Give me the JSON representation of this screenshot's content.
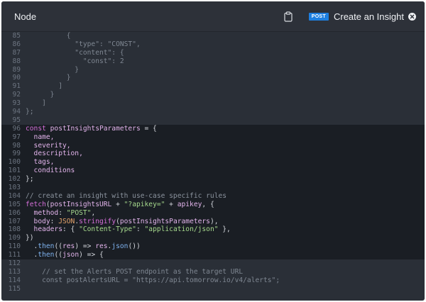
{
  "header": {
    "language": "Node",
    "method_badge": "POST",
    "endpoint_title": "Create an Insight"
  },
  "icons": {
    "clipboard": "clipboard-icon",
    "close": "close-circle-icon"
  },
  "colors": {
    "panel_bg": "#2a2f37",
    "highlight_bg": "#1a1e24",
    "method_badge_bg": "#1e7fe0"
  },
  "code": {
    "lines": [
      {
        "n": "85",
        "hl": false,
        "tokens": [
          {
            "t": "          {",
            "c": "dim"
          }
        ]
      },
      {
        "n": "86",
        "hl": false,
        "tokens": [
          {
            "t": "            \"type\": \"CONST\",",
            "c": "dim"
          }
        ]
      },
      {
        "n": "87",
        "hl": false,
        "tokens": [
          {
            "t": "            \"content\": {",
            "c": "dim"
          }
        ]
      },
      {
        "n": "88",
        "hl": false,
        "tokens": [
          {
            "t": "              \"const\": 2",
            "c": "dim"
          }
        ]
      },
      {
        "n": "89",
        "hl": false,
        "tokens": [
          {
            "t": "            }",
            "c": "dim"
          }
        ]
      },
      {
        "n": "90",
        "hl": false,
        "tokens": [
          {
            "t": "          }",
            "c": "dim"
          }
        ]
      },
      {
        "n": "91",
        "hl": false,
        "tokens": [
          {
            "t": "        ]",
            "c": "dim"
          }
        ]
      },
      {
        "n": "92",
        "hl": false,
        "tokens": [
          {
            "t": "      }",
            "c": "dim"
          }
        ]
      },
      {
        "n": "93",
        "hl": false,
        "tokens": [
          {
            "t": "    ]",
            "c": "dim"
          }
        ]
      },
      {
        "n": "94",
        "hl": false,
        "tokens": [
          {
            "t": "};",
            "c": "dim"
          }
        ]
      },
      {
        "n": "95",
        "hl": false,
        "tokens": [
          {
            "t": "",
            "c": "dim"
          }
        ]
      },
      {
        "n": "96",
        "hl": true,
        "tokens": [
          {
            "t": "const ",
            "c": "kw"
          },
          {
            "t": "postInsightsParameters",
            "c": "var"
          },
          {
            "t": " = {",
            "c": "pl"
          }
        ]
      },
      {
        "n": "97",
        "hl": true,
        "tokens": [
          {
            "t": "  name,",
            "c": "var"
          }
        ]
      },
      {
        "n": "98",
        "hl": true,
        "tokens": [
          {
            "t": "  severity,",
            "c": "var"
          }
        ]
      },
      {
        "n": "99",
        "hl": true,
        "tokens": [
          {
            "t": "  description,",
            "c": "var"
          }
        ]
      },
      {
        "n": "100",
        "hl": true,
        "tokens": [
          {
            "t": "  tags,",
            "c": "var"
          }
        ]
      },
      {
        "n": "101",
        "hl": true,
        "tokens": [
          {
            "t": "  conditions",
            "c": "var"
          }
        ]
      },
      {
        "n": "102",
        "hl": true,
        "tokens": [
          {
            "t": "};",
            "c": "pl"
          }
        ]
      },
      {
        "n": "103",
        "hl": true,
        "tokens": [
          {
            "t": "",
            "c": "pl"
          }
        ]
      },
      {
        "n": "104",
        "hl": true,
        "tokens": [
          {
            "t": "// create an insight with use-case specific rules",
            "c": "cm"
          }
        ]
      },
      {
        "n": "105",
        "hl": true,
        "tokens": [
          {
            "t": "fetch",
            "c": "kw"
          },
          {
            "t": "(",
            "c": "pl"
          },
          {
            "t": "postInsightsURL",
            "c": "var"
          },
          {
            "t": " + ",
            "c": "pl"
          },
          {
            "t": "\"?apikey=\"",
            "c": "str"
          },
          {
            "t": " + ",
            "c": "pl"
          },
          {
            "t": "apikey",
            "c": "var"
          },
          {
            "t": ", {",
            "c": "pl"
          }
        ]
      },
      {
        "n": "106",
        "hl": true,
        "tokens": [
          {
            "t": "  method",
            "c": "var"
          },
          {
            "t": ": ",
            "c": "pl"
          },
          {
            "t": "\"POST\"",
            "c": "str"
          },
          {
            "t": ",",
            "c": "pl"
          }
        ]
      },
      {
        "n": "107",
        "hl": true,
        "tokens": [
          {
            "t": "  body",
            "c": "var"
          },
          {
            "t": ": ",
            "c": "pl"
          },
          {
            "t": "JSON",
            "c": "num"
          },
          {
            "t": ".",
            "c": "pl"
          },
          {
            "t": "stringify",
            "c": "kw"
          },
          {
            "t": "(",
            "c": "pl"
          },
          {
            "t": "postInsightsParameters",
            "c": "var"
          },
          {
            "t": "),",
            "c": "pl"
          }
        ]
      },
      {
        "n": "108",
        "hl": true,
        "tokens": [
          {
            "t": "  headers",
            "c": "var"
          },
          {
            "t": ": { ",
            "c": "pl"
          },
          {
            "t": "\"Content-Type\"",
            "c": "str"
          },
          {
            "t": ": ",
            "c": "pl"
          },
          {
            "t": "\"application/json\"",
            "c": "str"
          },
          {
            "t": " },",
            "c": "pl"
          }
        ]
      },
      {
        "n": "109",
        "hl": true,
        "tokens": [
          {
            "t": "})",
            "c": "pl"
          }
        ]
      },
      {
        "n": "110",
        "hl": true,
        "tokens": [
          {
            "t": "  .",
            "c": "pl"
          },
          {
            "t": "then",
            "c": "fn"
          },
          {
            "t": "((",
            "c": "pl"
          },
          {
            "t": "res",
            "c": "var"
          },
          {
            "t": ") => ",
            "c": "pl"
          },
          {
            "t": "res",
            "c": "var"
          },
          {
            "t": ".",
            "c": "pl"
          },
          {
            "t": "json",
            "c": "fn"
          },
          {
            "t": "())",
            "c": "pl"
          }
        ]
      },
      {
        "n": "111",
        "hl": true,
        "tokens": [
          {
            "t": "  .",
            "c": "pl"
          },
          {
            "t": "then",
            "c": "fn"
          },
          {
            "t": "((",
            "c": "pl"
          },
          {
            "t": "json",
            "c": "var"
          },
          {
            "t": ") => {",
            "c": "pl"
          }
        ]
      },
      {
        "n": "112",
        "hl": false,
        "tokens": [
          {
            "t": "",
            "c": "dim"
          }
        ]
      },
      {
        "n": "113",
        "hl": false,
        "tokens": [
          {
            "t": "    // set the Alerts POST endpoint as the target URL",
            "c": "dim"
          }
        ]
      },
      {
        "n": "114",
        "hl": false,
        "tokens": [
          {
            "t": "    const postAlertsURL = \"https://api.tomorrow.io/v4/alerts\";",
            "c": "dim"
          }
        ]
      },
      {
        "n": "115",
        "hl": false,
        "tokens": [
          {
            "t": "",
            "c": "dim"
          }
        ]
      }
    ]
  }
}
